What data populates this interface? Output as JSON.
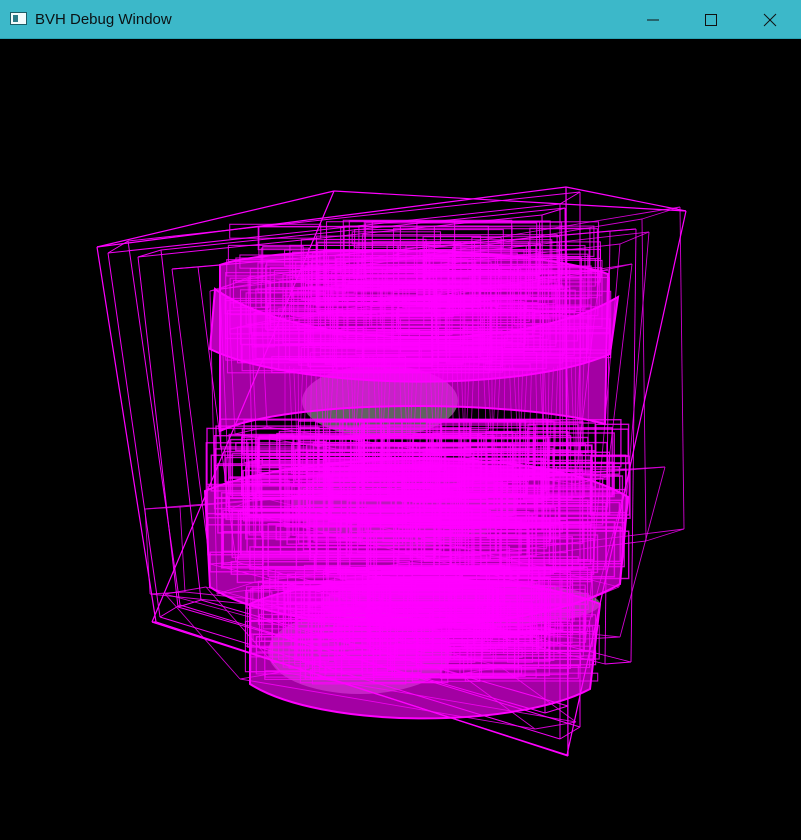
{
  "window": {
    "title": "BVH Debug Window",
    "icons": {
      "app": "app-window-icon",
      "minimize": "minimize-icon",
      "maximize": "maximize-icon",
      "close": "close-icon"
    }
  },
  "viewport": {
    "background": "#000000",
    "wire_color": "#ff00ff",
    "mesh_color": "#a8a8a8"
  }
}
